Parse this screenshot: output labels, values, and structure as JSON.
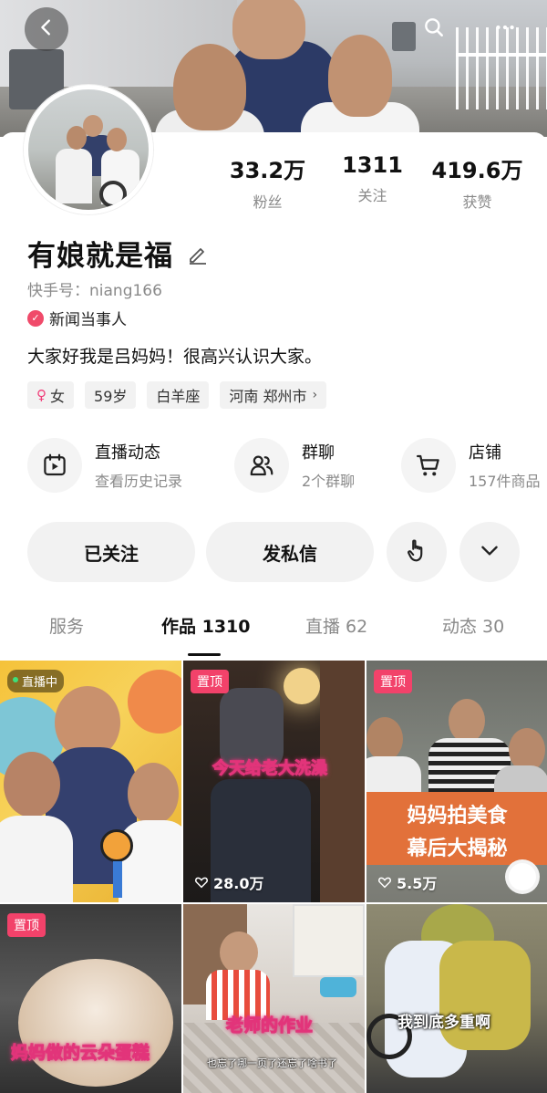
{
  "profile": {
    "name": "有娘就是福",
    "kuaishou_id": "快手号：niang166",
    "verified_label": "新闻当事人",
    "bio": "大家好我是吕妈妈！很高兴认识大家。"
  },
  "stats": [
    {
      "value": "33.2万",
      "label": "粉丝"
    },
    {
      "value": "1311",
      "label": "关注"
    },
    {
      "value": "419.6万",
      "label": "获赞"
    }
  ],
  "tags": {
    "gender": "女",
    "age": "59岁",
    "zodiac": "白羊座",
    "location": "河南 郑州市"
  },
  "features": [
    {
      "title": "直播动态",
      "sub": "查看历史记录",
      "icon": "calendar-play-icon"
    },
    {
      "title": "群聊",
      "sub": "2个群聊",
      "icon": "group-icon"
    },
    {
      "title": "店铺",
      "sub": "157件商品",
      "icon": "cart-icon"
    }
  ],
  "buttons": {
    "followed": "已关注",
    "message": "发私信"
  },
  "tabs": [
    {
      "label": "服务"
    },
    {
      "label": "作品 1310"
    },
    {
      "label": "直播 62"
    },
    {
      "label": "动态 30"
    }
  ],
  "videos": [
    {
      "badge": "直播中",
      "caption": "",
      "likes": ""
    },
    {
      "badge": "置顶",
      "caption": "今天给老大洗澡",
      "likes": "28.0万"
    },
    {
      "badge": "置顶",
      "caption": "妈妈拍美食",
      "caption2": "幕后大揭秘",
      "likes": "5.5万"
    },
    {
      "badge": "置顶",
      "caption": "妈妈做的云朵蛋糕",
      "likes": ""
    },
    {
      "badge": "",
      "caption": "老师的作业",
      "subtitle": "也忘了哪一页了还忘了啥书了",
      "likes": ""
    },
    {
      "badge": "",
      "caption": "我到底多重啊",
      "likes": ""
    }
  ],
  "colors": {
    "pin_badge": "#f2426a",
    "verified_badge": "#f04a6a",
    "caption_stroke": "#e2347a"
  }
}
